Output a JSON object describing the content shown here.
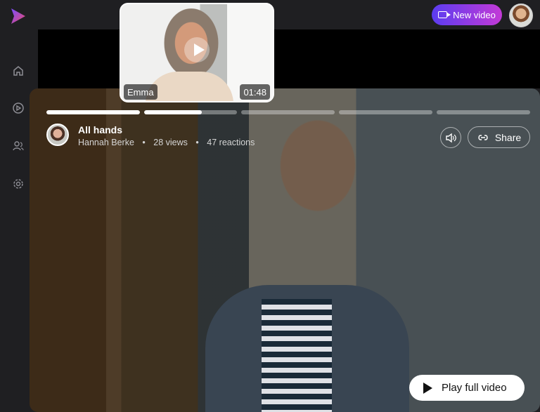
{
  "topbar": {
    "new_video_label": "New video",
    "logo_icon": "app-logo-icon",
    "camera_icon": "video-camera-icon",
    "user_avatar_icon": "user-avatar"
  },
  "sidebar": {
    "items": [
      {
        "name": "home",
        "icon": "home-icon"
      },
      {
        "name": "videos",
        "icon": "play-circle-icon"
      },
      {
        "name": "people",
        "icon": "users-icon"
      },
      {
        "name": "settings",
        "icon": "gear-icon"
      }
    ]
  },
  "preview": {
    "name": "Emma",
    "duration": "01:48",
    "play_icon": "play-icon"
  },
  "player": {
    "progress_segments": [
      1,
      0.62,
      0,
      0,
      0
    ],
    "title": "All hands",
    "host": "Hannah Berke",
    "views": "28 views",
    "reactions": "47 reactions",
    "share_label": "Share",
    "play_full_label": "Play full video",
    "volume_icon": "volume-icon",
    "link_icon": "link-icon"
  },
  "colors": {
    "background": "#1f1f22",
    "new_video_gradient_start": "#5b3cf0",
    "new_video_gradient_end": "#c33ad6",
    "logo_purple": "#7b4cff",
    "logo_pink": "#e84c6f"
  }
}
